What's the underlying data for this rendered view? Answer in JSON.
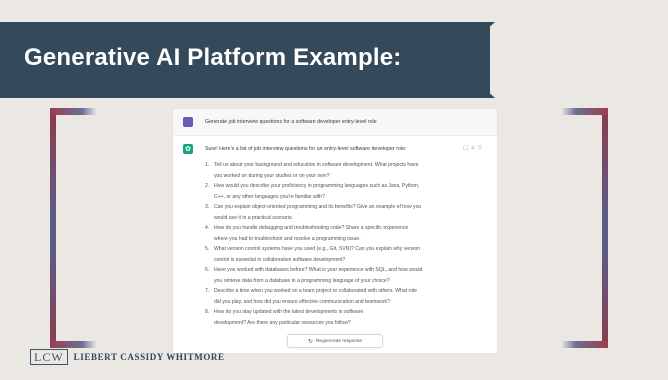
{
  "slide": {
    "title": "Generative AI Platform Example:"
  },
  "chat": {
    "user_prompt": "Generate job interview questions for a software developer entry-level role",
    "ai_intro": "Sure! Here's a list of job interview questions for an entry-level software developer role:",
    "questions": [
      {
        "num": "1.",
        "text": "Tell us about your background and education in software development. What projects have"
      },
      {
        "num": "",
        "text": "you worked on during your studies or on your own?"
      },
      {
        "num": "2.",
        "text": "How would you describe your proficiency in programming languages such as Java, Python,"
      },
      {
        "num": "",
        "text": "C++, or any other languages you're familiar with?"
      },
      {
        "num": "3.",
        "text": "Can you explain object-oriented programming and its benefits? Give an example of how you"
      },
      {
        "num": "",
        "text": "would use it in a practical scenario."
      },
      {
        "num": "4.",
        "text": "How do you handle debugging and troubleshooting code? Share a specific experience"
      },
      {
        "num": "",
        "text": "where you had to troubleshoot and resolve a programming issue."
      },
      {
        "num": "5.",
        "text": "What version control systems have you used (e.g., Git, SVN)? Can you explain why version"
      },
      {
        "num": "",
        "text": "control is essential in collaborative software development?"
      },
      {
        "num": "6.",
        "text": "Have you worked with databases before? What is your experience with SQL, and how would"
      },
      {
        "num": "",
        "text": "you retrieve data from a database in a programming language of your choice?"
      },
      {
        "num": "7.",
        "text": "Describe a time when you worked on a team project or collaborated with others. What role"
      },
      {
        "num": "",
        "text": "did you play, and how did you ensure effective communication and teamwork?"
      },
      {
        "num": "8.",
        "text": "How do you stay updated with the latest developments in software"
      },
      {
        "num": "",
        "text": "development? Are there any particular resources you follow?"
      }
    ],
    "regenerate_label": "Regenerate response",
    "feedback_icons": "copy-icon thumbs-up-icon thumbs-down-icon"
  },
  "footer": {
    "logo_mark": "LCW",
    "firm_name": "LIEBERT CASSIDY WHITMORE"
  },
  "colors": {
    "banner": "#34495a",
    "background": "#ebe8e4",
    "bracket_red": "#9a3c4e",
    "bracket_blue": "#5a5d86",
    "ai_green": "#19a37f",
    "user_purple": "#6a5bb6"
  }
}
